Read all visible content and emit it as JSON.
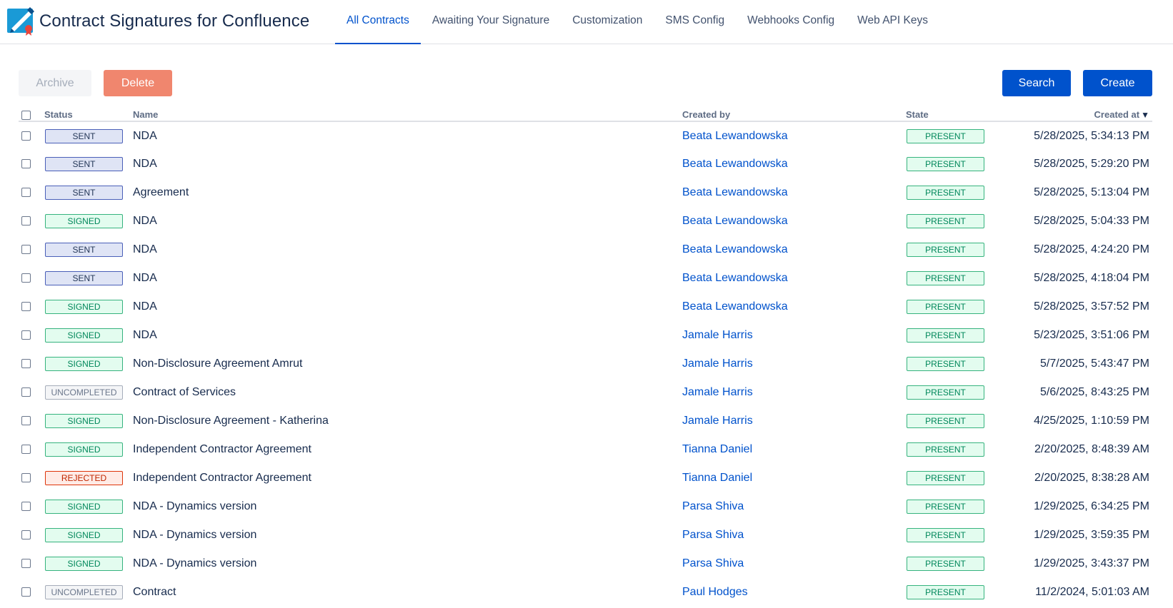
{
  "app": {
    "title": "Contract Signatures for Confluence"
  },
  "tabs": [
    {
      "label": "All Contracts",
      "active": true
    },
    {
      "label": "Awaiting Your Signature",
      "active": false
    },
    {
      "label": "Customization",
      "active": false
    },
    {
      "label": "SMS Config",
      "active": false
    },
    {
      "label": "Webhooks Config",
      "active": false
    },
    {
      "label": "Web API Keys",
      "active": false
    }
  ],
  "toolbar": {
    "archive_label": "Archive",
    "delete_label": "Delete",
    "search_label": "Search",
    "create_label": "Create"
  },
  "table": {
    "headers": {
      "status": "Status",
      "name": "Name",
      "created_by": "Created by",
      "state": "State",
      "created_at": "Created at"
    },
    "sort": {
      "column": "created_at",
      "direction": "desc",
      "icon": "sort-down-icon"
    },
    "rows": [
      {
        "status": "SENT",
        "name": "NDA",
        "created_by": "Beata Lewandowska",
        "state": "PRESENT",
        "created_at": "5/28/2025, 5:34:13 PM"
      },
      {
        "status": "SENT",
        "name": "NDA",
        "created_by": "Beata Lewandowska",
        "state": "PRESENT",
        "created_at": "5/28/2025, 5:29:20 PM"
      },
      {
        "status": "SENT",
        "name": "Agreement",
        "created_by": "Beata Lewandowska",
        "state": "PRESENT",
        "created_at": "5/28/2025, 5:13:04 PM"
      },
      {
        "status": "SIGNED",
        "name": "NDA",
        "created_by": "Beata Lewandowska",
        "state": "PRESENT",
        "created_at": "5/28/2025, 5:04:33 PM"
      },
      {
        "status": "SENT",
        "name": "NDA",
        "created_by": "Beata Lewandowska",
        "state": "PRESENT",
        "created_at": "5/28/2025, 4:24:20 PM"
      },
      {
        "status": "SENT",
        "name": "NDA",
        "created_by": "Beata Lewandowska",
        "state": "PRESENT",
        "created_at": "5/28/2025, 4:18:04 PM"
      },
      {
        "status": "SIGNED",
        "name": "NDA",
        "created_by": "Beata Lewandowska",
        "state": "PRESENT",
        "created_at": "5/28/2025, 3:57:52 PM"
      },
      {
        "status": "SIGNED",
        "name": "NDA",
        "created_by": "Jamale Harris",
        "state": "PRESENT",
        "created_at": "5/23/2025, 3:51:06 PM"
      },
      {
        "status": "SIGNED",
        "name": "Non-Disclosure Agreement Amrut",
        "created_by": "Jamale Harris",
        "state": "PRESENT",
        "created_at": "5/7/2025, 5:43:47 PM"
      },
      {
        "status": "UNCOMPLETED",
        "name": "Contract of Services",
        "created_by": "Jamale Harris",
        "state": "PRESENT",
        "created_at": "5/6/2025, 8:43:25 PM"
      },
      {
        "status": "SIGNED",
        "name": "Non-Disclosure Agreement - Katherina",
        "created_by": "Jamale Harris",
        "state": "PRESENT",
        "created_at": "4/25/2025, 1:10:59 PM"
      },
      {
        "status": "SIGNED",
        "name": "Independent Contractor Agreement",
        "created_by": "Tianna Daniel",
        "state": "PRESENT",
        "created_at": "2/20/2025, 8:48:39 AM"
      },
      {
        "status": "REJECTED",
        "name": "Independent Contractor Agreement",
        "created_by": "Tianna Daniel",
        "state": "PRESENT",
        "created_at": "2/20/2025, 8:38:28 AM"
      },
      {
        "status": "SIGNED",
        "name": "NDA - Dynamics version",
        "created_by": "Parsa Shiva",
        "state": "PRESENT",
        "created_at": "1/29/2025, 6:34:25 PM"
      },
      {
        "status": "SIGNED",
        "name": "NDA - Dynamics version",
        "created_by": "Parsa Shiva",
        "state": "PRESENT",
        "created_at": "1/29/2025, 3:59:35 PM"
      },
      {
        "status": "SIGNED",
        "name": "NDA - Dynamics version",
        "created_by": "Parsa Shiva",
        "state": "PRESENT",
        "created_at": "1/29/2025, 3:43:37 PM"
      },
      {
        "status": "UNCOMPLETED",
        "name": "Contract",
        "created_by": "Paul Hodges",
        "state": "PRESENT",
        "created_at": "11/2/2024, 5:01:03 AM"
      }
    ]
  },
  "colors": {
    "accent": "#0052cc",
    "delete": "#f0866e",
    "sent": "#4a5fb8",
    "signed": "#36b37e",
    "rejected": "#de350b",
    "uncompleted": "#a5adba"
  }
}
